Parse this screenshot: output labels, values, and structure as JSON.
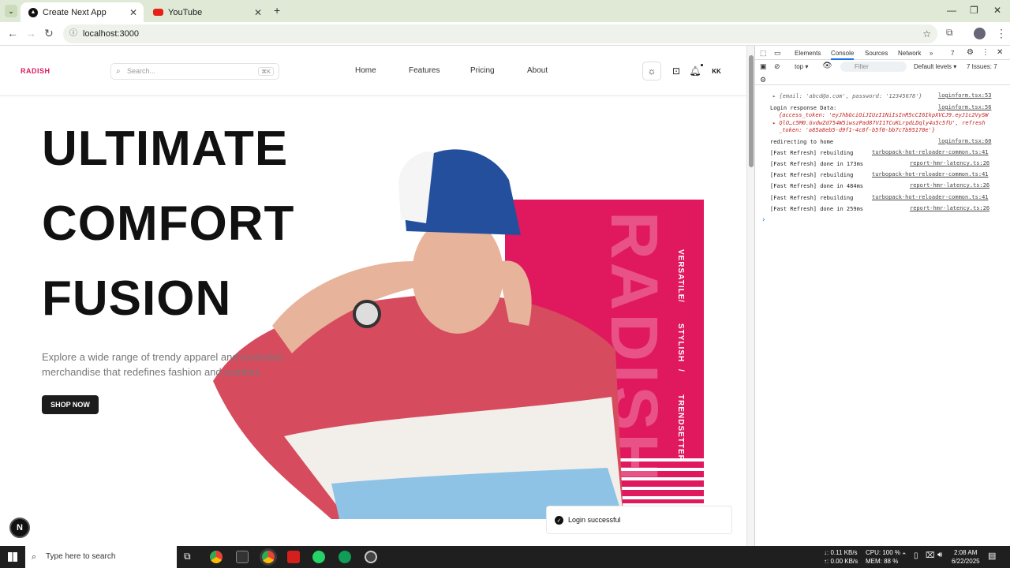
{
  "browser": {
    "tabs": [
      {
        "title": "Create Next App",
        "active": true
      },
      {
        "title": "YouTube",
        "active": false
      }
    ],
    "new_tab": "+",
    "address": "localhost:3000"
  },
  "site": {
    "logo": "RADISH",
    "search_placeholder": "Search...",
    "search_shortcut": "⌘K",
    "nav": [
      "Home",
      "Features",
      "Pricing",
      "About"
    ],
    "avatar": "KK",
    "hero_lines": [
      "ULTIMATE",
      "COMFORT",
      "FUSION"
    ],
    "hero_subtitle": "Explore a wide range of trendy apparel and exclusive merchandise that redefines fashion and comfort.",
    "cta": "SHOP NOW",
    "panel_brand": "RADISH",
    "panel_tags": [
      "VERSATILE",
      "/",
      "STYLISH",
      "/",
      "TRENDSETTER"
    ],
    "toast": "Login successful",
    "next_badge": "N"
  },
  "devtools": {
    "tabs": [
      "Elements",
      "Console",
      "Sources",
      "Network",
      "»"
    ],
    "issues_badge": "7",
    "context": "top ▾",
    "filter_placeholder": "Filter",
    "levels": "Default levels ▾",
    "issues": "7 Issues: 7",
    "logs": [
      {
        "text": "▸ {email: 'abcd@a.com', password: '12345678'}",
        "source": "loginform.tsx:53"
      },
      {
        "text": "Login response Data:",
        "source": "loginform.tsx:56"
      },
      {
        "text": "{access_token: 'eyJhbGciOiJIUzI1NiIsInR5cCI6IkpXVCJ9.eyJ1c2VySW",
        "source": ""
      },
      {
        "text": "▸ QlO…c5M0.GvdwZd754W5iwszPad87VI1TCuKLrpdLDqly4u5c5fU', refresh",
        "source": ""
      },
      {
        "text": "_token: 'a85a8eb5-d9f1-4c8f-b5f0-bb7c7b95170e'}",
        "source": ""
      },
      {
        "text": "redirecting to home",
        "source": "loginform.tsx:60"
      },
      {
        "text": "[Fast Refresh] rebuilding",
        "source": "turbopack-hot-reloader-common.ts:41"
      },
      {
        "text": "[Fast Refresh] done in 173ms",
        "source": "report-hmr-latency.ts:26"
      },
      {
        "text": "[Fast Refresh] rebuilding",
        "source": "turbopack-hot-reloader-common.ts:41"
      },
      {
        "text": "[Fast Refresh] done in 484ms",
        "source": "report-hmr-latency.ts:26"
      },
      {
        "text": "[Fast Refresh] rebuilding",
        "source": "turbopack-hot-reloader-common.ts:41"
      },
      {
        "text": "[Fast Refresh] done in 259ms",
        "source": "report-hmr-latency.ts:26"
      }
    ],
    "prompt": "›"
  },
  "taskbar": {
    "search": "Type here to search",
    "net_up": "↓: 0.11 KB/s",
    "net_down": "↑: 0.00 KB/s",
    "cpu": "CPU: 100 %",
    "mem": "MEM: 88 %",
    "time": "2:08 AM",
    "date": "6/22/2025"
  }
}
